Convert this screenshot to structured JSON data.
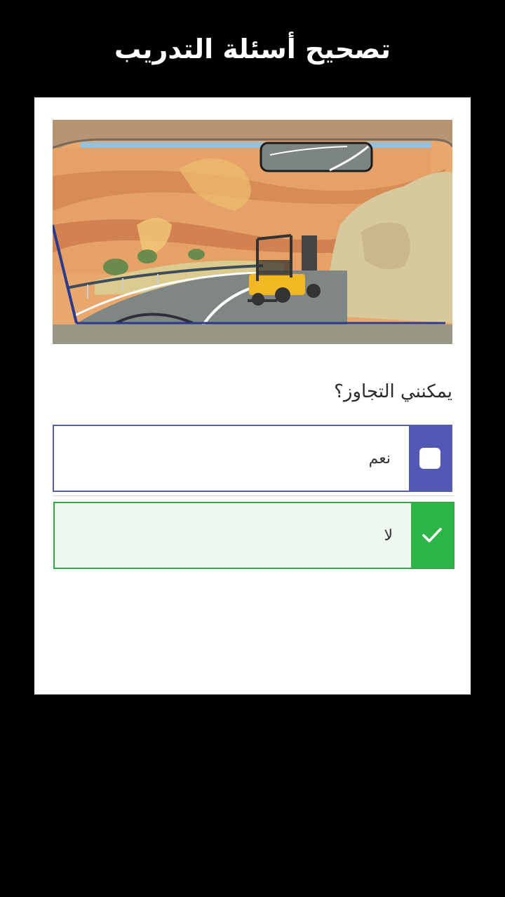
{
  "header": {
    "title": "تصحيح أسئلة التدريب"
  },
  "question": {
    "text": "يمكنني التجاوز؟",
    "image_icon": "car-windshield-forklift-scene"
  },
  "answers": [
    {
      "label": "نعم",
      "state": "unchecked",
      "color": "#5258b4"
    },
    {
      "label": "لا",
      "state": "correct",
      "color": "#2db548"
    }
  ],
  "colors": {
    "correct": "#2db548",
    "option_accent": "#5258b4",
    "background": "#000000",
    "card": "#ffffff"
  }
}
